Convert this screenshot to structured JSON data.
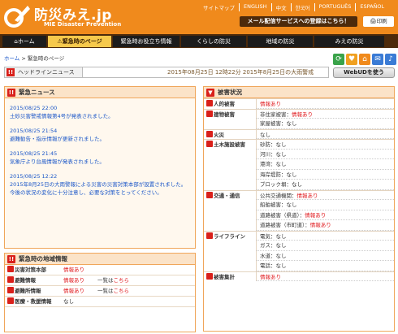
{
  "header": {
    "title": "防災みえ.jp",
    "subtitle": "MIE Disaster Prevention",
    "toplinks": [
      "サイトマップ",
      "ENGLISH",
      "中文",
      "한국어",
      "PORTUGUÊS",
      "ESPAÑOL"
    ],
    "mail_button": "メール配信サービスへの登録はこちら！",
    "print_button": "印刷"
  },
  "nav": [
    {
      "label": "ホーム"
    },
    {
      "label": "緊急時のページ"
    },
    {
      "label": "緊急時お役立ち情報"
    },
    {
      "label": "くらしの防災"
    },
    {
      "label": "地域の防災"
    },
    {
      "label": "みえの防災"
    }
  ],
  "breadcrumb": {
    "home": "ホーム",
    "sep": " > ",
    "current": "緊急時のページ"
  },
  "headline": {
    "label": "ヘッドラインニュース",
    "text": "2015年08月25日 12時22分 2015年8月25日の大雨警戒"
  },
  "webud_button": "WebUDを使う",
  "emergency_news": {
    "title": "緊急ニュース",
    "items": [
      {
        "date": "2015/08/25 22:00",
        "text": "土砂災害警戒情報第4号が発表されました。"
      },
      {
        "date": "2015/08/25 21:54",
        "text": "避難勧告・指示情報が更新されました。"
      },
      {
        "date": "2015/08/25 21:45",
        "text": "気象庁より台風情報が発表されました。"
      },
      {
        "date": "2015/08/25 12:22",
        "text": "2015年8月25日の大雨警報による災害の災害対策本部が設置されました。今後の状況の変化に十分注意し、必要な対策をとってください。"
      }
    ]
  },
  "area_info": {
    "title": "緊急時の地域情報",
    "rows": [
      {
        "label": "災害対策本部",
        "status": "情報あり",
        "extra_prefix": "",
        "extra_link": ""
      },
      {
        "label": "避難情報",
        "status": "情報あり",
        "extra_prefix": "一覧は",
        "extra_link": "こちら"
      },
      {
        "label": "避難所情報",
        "status": "情報あり",
        "extra_prefix": "一覧は",
        "extra_link": "こちら"
      },
      {
        "label": "医療・救援情報",
        "status": "なし",
        "extra_prefix": "",
        "extra_link": ""
      }
    ]
  },
  "damage": {
    "title": "被害状況",
    "rows": [
      {
        "cat": "人的被害",
        "sub": "",
        "value": "情報あり",
        "red": true,
        "start": true
      },
      {
        "cat": "建物被害",
        "sub": "非住家被害：",
        "value": "情報あり",
        "red": true,
        "start": true
      },
      {
        "cat": "",
        "sub": "家屋被害：",
        "value": "なし",
        "red": false,
        "start": false
      },
      {
        "cat": "火災",
        "sub": "",
        "value": "なし",
        "red": false,
        "start": true
      },
      {
        "cat": "土木施設被害",
        "sub": "砂防：",
        "value": "なし",
        "red": false,
        "start": true
      },
      {
        "cat": "",
        "sub": "河川：",
        "value": "なし",
        "red": false,
        "start": false
      },
      {
        "cat": "",
        "sub": "港湾：",
        "value": "なし",
        "red": false,
        "start": false
      },
      {
        "cat": "",
        "sub": "海岸堤防：",
        "value": "なし",
        "red": false,
        "start": false
      },
      {
        "cat": "",
        "sub": "ブロック塀：",
        "value": "なし",
        "red": false,
        "start": false
      },
      {
        "cat": "交通・通信",
        "sub": "公共交通機関：",
        "value": "情報あり",
        "red": true,
        "start": true
      },
      {
        "cat": "",
        "sub": "船舶被害：",
        "value": "なし",
        "red": false,
        "start": false
      },
      {
        "cat": "",
        "sub": "道路被害（県道）：",
        "value": "情報あり",
        "red": true,
        "start": false
      },
      {
        "cat": "",
        "sub": "道路被害（市町道）：",
        "value": "情報あり",
        "red": true,
        "start": false
      },
      {
        "cat": "ライフライン",
        "sub": "電気：",
        "value": "なし",
        "red": false,
        "start": true
      },
      {
        "cat": "",
        "sub": "ガス：",
        "value": "なし",
        "red": false,
        "start": false
      },
      {
        "cat": "",
        "sub": "水道：",
        "value": "なし",
        "red": false,
        "start": false
      },
      {
        "cat": "",
        "sub": "電話：",
        "value": "なし",
        "red": false,
        "start": false
      },
      {
        "cat": "被害集計",
        "sub": "",
        "value": "情報あり",
        "red": true,
        "start": true
      }
    ]
  },
  "colors": {
    "brand_orange": "#f08a1c",
    "nav_brown": "#4d2a0b",
    "active_tab": "#f6c94c",
    "alert_red": "#e0161a",
    "link_blue": "#1a56c8"
  }
}
